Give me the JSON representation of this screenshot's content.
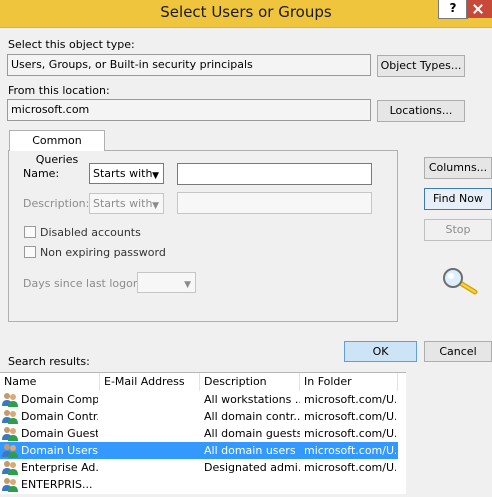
{
  "window": {
    "title": "Select Users or Groups",
    "help_label": "?"
  },
  "object_type": {
    "label": "Select this object type:",
    "value": "Users, Groups, or Built-in security principals",
    "button": "Object Types..."
  },
  "location": {
    "label": "From this location:",
    "value": "microsoft.com",
    "button": "Locations..."
  },
  "queries": {
    "tab": "Common Queries",
    "name_label": "Name:",
    "name_mode": "Starts with",
    "name_value": "",
    "description_label": "Description:",
    "description_mode": "Starts with",
    "description_value": "",
    "disabled_accounts": "Disabled accounts",
    "non_expiring": "Non expiring password",
    "days_label": "Days since last logon:",
    "days_value": ""
  },
  "side_buttons": {
    "columns": "Columns...",
    "find_now": "Find Now",
    "stop": "Stop"
  },
  "footer": {
    "results_label": "Search results:",
    "ok": "OK",
    "cancel": "Cancel"
  },
  "results": {
    "columns": [
      "Name",
      "E-Mail Address",
      "Description",
      "In Folder"
    ],
    "rows": [
      {
        "name": "Domain Comp...",
        "email": "",
        "description": "All workstations ...",
        "folder": "microsoft.com/U...",
        "selected": false
      },
      {
        "name": "Domain Contr...",
        "email": "",
        "description": "All domain contr...",
        "folder": "microsoft.com/U...",
        "selected": false
      },
      {
        "name": "Domain Guests",
        "email": "",
        "description": "All domain guests",
        "folder": "microsoft.com/U...",
        "selected": false
      },
      {
        "name": "Domain Users",
        "email": "",
        "description": "All domain users",
        "folder": "microsoft.com/U...",
        "selected": true
      },
      {
        "name": "Enterprise Ad...",
        "email": "",
        "description": "Designated admi...",
        "folder": "microsoft.com/U...",
        "selected": false
      },
      {
        "name": "ENTERPRIS...",
        "email": "",
        "description": "",
        "folder": "",
        "selected": false
      }
    ]
  },
  "colors": {
    "titlebar": "#f0c53e",
    "close": "#c7493a",
    "selection": "#3399ff"
  },
  "icons": {
    "search": "magnifier-icon",
    "user_group": "user-group-icon"
  }
}
